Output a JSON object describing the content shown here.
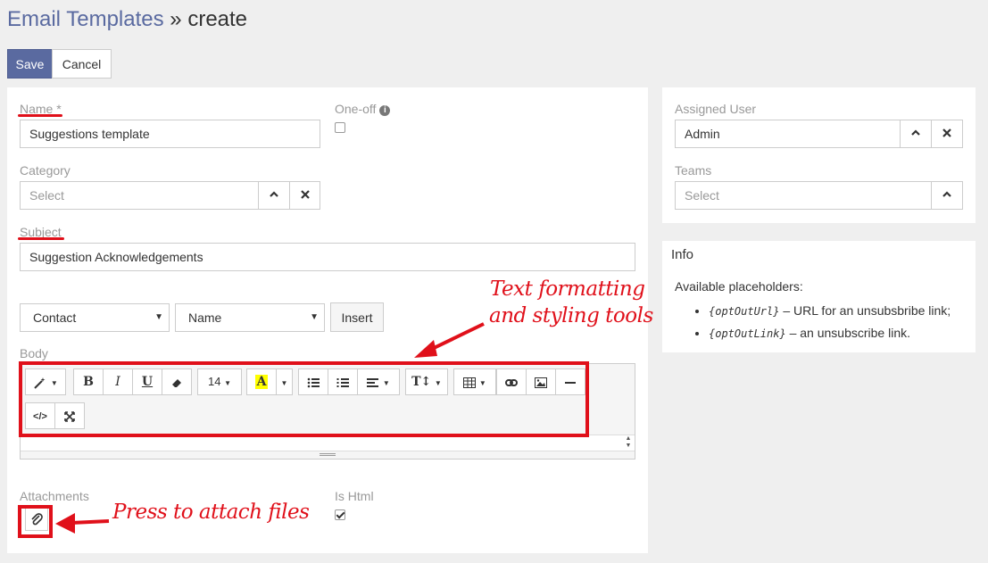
{
  "header": {
    "link": "Email Templates",
    "separator": " » ",
    "current": "create"
  },
  "actions": {
    "save": "Save",
    "cancel": "Cancel"
  },
  "form": {
    "name_label": "Name *",
    "name_value": "Suggestions template",
    "oneoff_label": "One-off",
    "category_label": "Category",
    "category_placeholder": "Select",
    "subject_label": "Subject",
    "subject_value": "Suggestion Acknowledgements",
    "placeholder_entity": "Contact",
    "placeholder_field": "Name",
    "insert_label": "Insert",
    "body_label": "Body",
    "font_size": "14",
    "attachments_label": "Attachments",
    "is_html_label": "Is Html"
  },
  "side": {
    "assigned_user_label": "Assigned User",
    "assigned_user_value": "Admin",
    "teams_label": "Teams",
    "teams_placeholder": "Select"
  },
  "info": {
    "title": "Info",
    "intro": "Available placeholders:",
    "items": [
      {
        "code": "{optOutUrl}",
        "text": " – URL for an unsubsbribe link;"
      },
      {
        "code": "{optOutLink}",
        "text": " – an unsubscribe link."
      }
    ]
  },
  "annotations": {
    "toolbar_line1": "Text formatting",
    "toolbar_line2": "and styling tools",
    "attach": "Press to attach files"
  },
  "colors": {
    "accent": "#5a6aa0",
    "annotation": "#e0101a",
    "highlight": "#ffff00"
  }
}
